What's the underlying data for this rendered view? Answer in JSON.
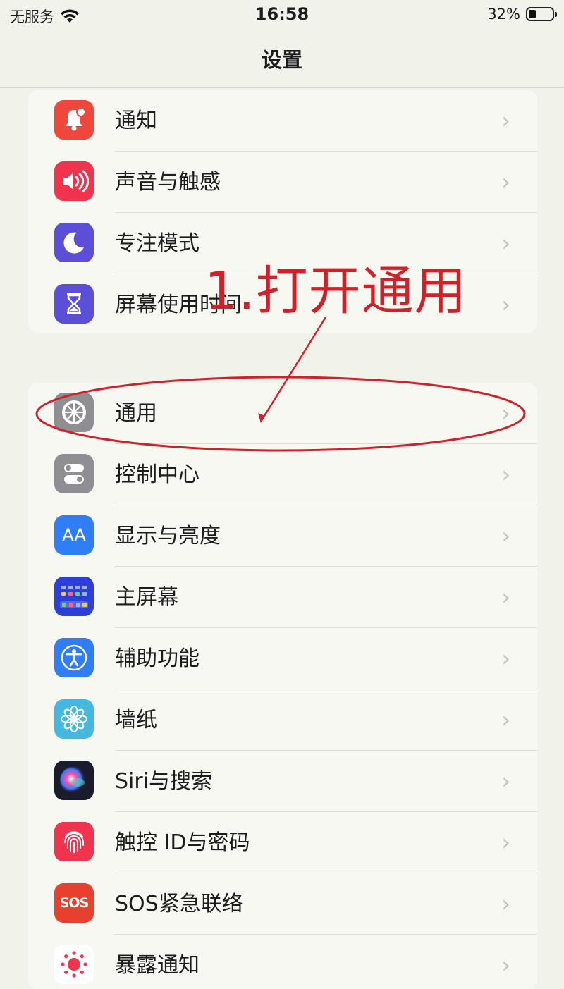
{
  "status_bar": {
    "carrier": "无服务",
    "time": "16:58",
    "battery_percent": "32%",
    "battery_level": 0.32
  },
  "nav": {
    "title": "设置"
  },
  "group1": [
    {
      "label": "通知",
      "icon": "bell-icon",
      "color": "#f0473d"
    },
    {
      "label": "声音与触感",
      "icon": "speaker-icon",
      "color": "#f0334e"
    },
    {
      "label": "专注模式",
      "icon": "moon-icon",
      "color": "#5b4fd8"
    },
    {
      "label": "屏幕使用时间",
      "icon": "hourglass-icon",
      "color": "#5b4fd8"
    }
  ],
  "group2": [
    {
      "label": "通用",
      "icon": "gear-icon",
      "color": "#8e8e93"
    },
    {
      "label": "控制中心",
      "icon": "toggles-icon",
      "color": "#8e8e93"
    },
    {
      "label": "显示与亮度",
      "icon": "text-size-icon",
      "color": "#2f7ef5"
    },
    {
      "label": "主屏幕",
      "icon": "home-grid-icon",
      "color": "#2c3fd6"
    },
    {
      "label": "辅助功能",
      "icon": "accessibility-icon",
      "color": "#2f7ef5"
    },
    {
      "label": "墙纸",
      "icon": "flower-icon",
      "color": "#45b8e0"
    },
    {
      "label": "Siri与搜索",
      "icon": "siri-icon",
      "color": "#1b1b2e"
    },
    {
      "label": "触控 ID与密码",
      "icon": "fingerprint-icon",
      "color": "#f0334e"
    },
    {
      "label": "SOS紧急联络",
      "icon": "sos-icon",
      "color": "#e8402f"
    },
    {
      "label": "暴露通知",
      "icon": "exposure-icon",
      "color": "#ffffff"
    }
  ],
  "annotation": {
    "text": "1.打开通用",
    "color": "#d0202a"
  },
  "sos_icon_text": "SOS",
  "aa_icon_text": "AA"
}
